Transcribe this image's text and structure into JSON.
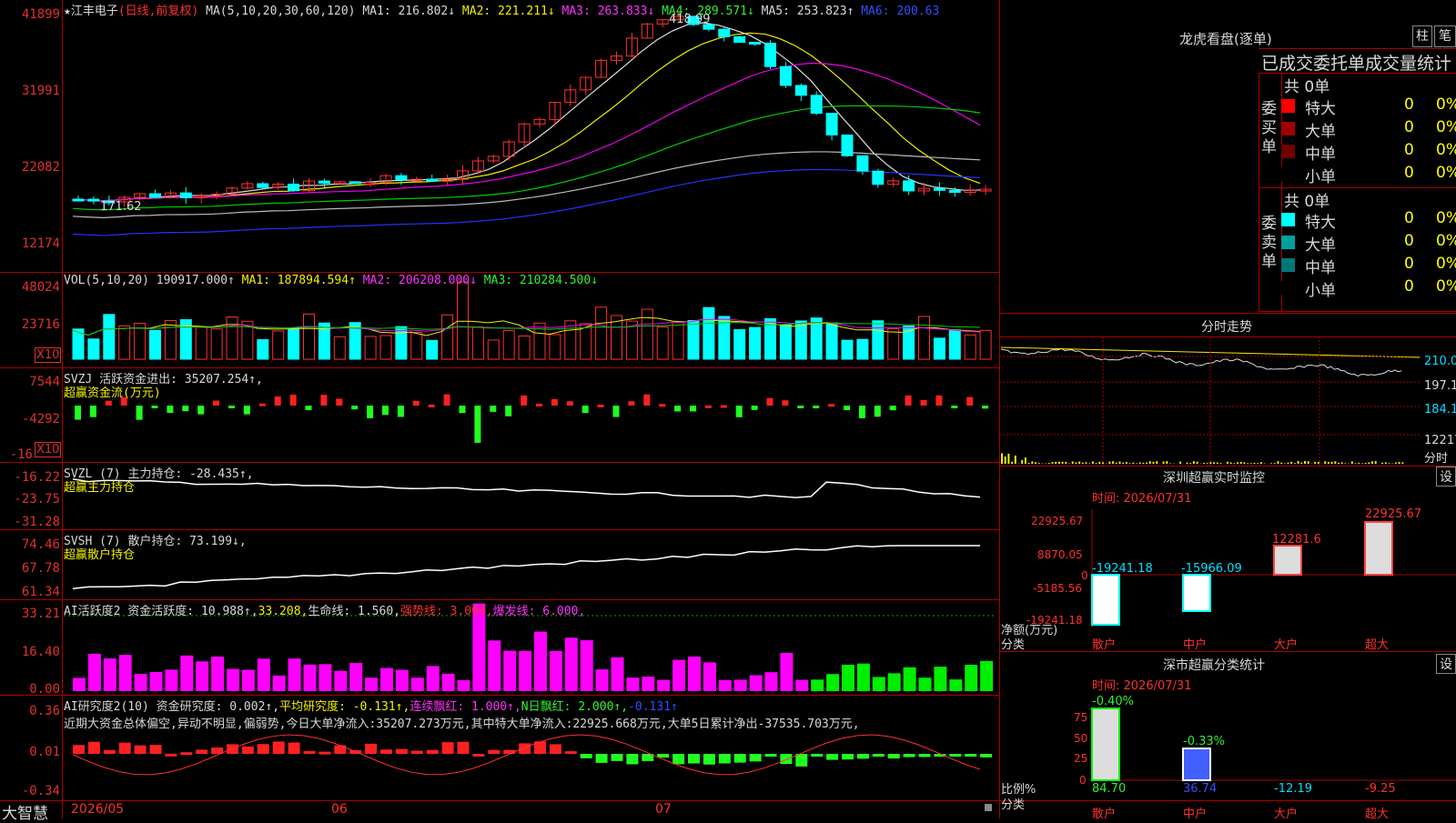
{
  "stock": {
    "name": "★江丰电子",
    "mode": "(日线,前复权)"
  },
  "main": {
    "ma_label": "MA(5,10,20,30,60,120)",
    "ma1": "MA1: 216.802↓",
    "ma2": "MA2: 221.211↓",
    "ma3": "MA3: 263.833↓",
    "ma4": "MA4: 289.571↓",
    "ma5": "MA5: 253.823↑",
    "ma6": "MA6: 200.63",
    "y": [
      "41899",
      "31991",
      "22082",
      "12174"
    ],
    "high_label": "418.99",
    "low_label": "171.62"
  },
  "vol": {
    "label": "VOL(5,10,20)",
    "v": "190917.000↑",
    "ma1": "MA1: 187894.594↑",
    "ma2": "MA2: 206208.000↓",
    "ma3": "MA3: 210284.500↓",
    "y": [
      "48024",
      "23716"
    ],
    "unit": "X10"
  },
  "svzj": {
    "label": "SVZJ  活跃资金进出: 35207.254↑,",
    "sub": "超赢资金流(万元)",
    "y": [
      "7544",
      "-4292",
      "-16"
    ],
    "unit": "X10"
  },
  "svzl": {
    "label": "SVZL (7) 主力持仓: -28.435↑,",
    "sub": "超赢主力持仓",
    "y": [
      "-16.22",
      "-23.75",
      "-31.28"
    ]
  },
  "svsh": {
    "label": "SVSH (7) 散户持仓: 73.199↓,",
    "sub": "超赢散户持仓",
    "y": [
      "74.46",
      "67.78",
      "61.34"
    ]
  },
  "ai2": {
    "l1": "AI活跃度2 资金活跃度: 10.988↑,",
    "l2": "33.208,",
    "l3": "生命线: 1.560,",
    "l4": "强势线: 3.000,",
    "l5": "爆发线: 6.000,",
    "y": [
      "33.21",
      "16.40",
      "0.00"
    ]
  },
  "ai3": {
    "l1": "AI研究度2(10) 资金研究度: 0.002↑,",
    "l2": "平均研究度: -0.131↑,",
    "l3": "连续飘红: 1.000↑,",
    "l4": "N日飘红: 2.000↑,",
    "l5": "-0.131↑",
    "comment": "近期大资金总体偏空,异动不明显,偏弱势,今日大单净流入:35207.273万元,其中特大单净流入:22925.668万元,大单5日累计净出-37535.703万元,",
    "y": [
      "0.36",
      "0.01",
      "-0.34"
    ]
  },
  "dates": {
    "brand": "大智慧",
    "d1": "2026/05",
    "d2": "06",
    "d3": "07"
  },
  "right": {
    "title": "龙虎看盘(逐单)",
    "btn1": "柱",
    "btn2": "笔",
    "table_header": "已成交委托单成交量统计",
    "buy_side": "委买单",
    "sell_side": "委卖单",
    "buy_total": "共 0单",
    "sell_total": "共 0单",
    "buy_rows": [
      {
        "label": "特大",
        "v": "0",
        "p": "0%",
        "color": "#ff0000"
      },
      {
        "label": "大单",
        "v": "0",
        "p": "0%",
        "color": "#a00000"
      },
      {
        "label": "中单",
        "v": "0",
        "p": "0%",
        "color": "#700000"
      },
      {
        "label": "小单",
        "v": "0",
        "p": "0%",
        "color": "#000000"
      }
    ],
    "sell_rows": [
      {
        "label": "特大",
        "v": "0",
        "p": "0%",
        "color": "#00ffff"
      },
      {
        "label": "大单",
        "v": "0",
        "p": "0%",
        "color": "#00a0a0"
      },
      {
        "label": "中单",
        "v": "0",
        "p": "0%",
        "color": "#007878"
      },
      {
        "label": "小单",
        "v": "0",
        "p": "0%",
        "color": "#000000"
      }
    ],
    "intraday_title": "分时走势",
    "intraday_y": [
      "210.0",
      "197.1",
      "184.1",
      "12217"
    ],
    "intraday_unit": "分时",
    "monitor_title": "深圳超赢实时监控",
    "monitor_btn": "设",
    "monitor_time": "时间: 2026/07/31",
    "monitor_y": [
      "22925.67",
      "8870.05",
      "0",
      "-5185.56",
      "-19241.18"
    ],
    "monitor_axis": "净额(万元)",
    "monitor_axis2": "分类",
    "monitor_bars": [
      {
        "cat": "散户",
        "value": "-19241.18"
      },
      {
        "cat": "中户",
        "value": "-15966.09"
      },
      {
        "cat": "大户",
        "value": "12281.6"
      },
      {
        "cat": "超大",
        "value": "22925.67"
      }
    ],
    "class_title": "深市超赢分类统计",
    "class_btn": "设",
    "class_time": "时间: 2026/07/31",
    "class_y": [
      "75",
      "50",
      "25",
      "0"
    ],
    "class_axis": "比例%",
    "class_axis2": "分类",
    "class_bars": [
      {
        "cat": "散户",
        "top": "-0.40%",
        "bottom": "84.70"
      },
      {
        "cat": "中户",
        "top": "-0.33%",
        "bottom": "36.74"
      },
      {
        "cat": "大户",
        "top": "",
        "bottom": "-12.19"
      },
      {
        "cat": "超大",
        "top": "",
        "bottom": "-9.25"
      }
    ]
  }
}
